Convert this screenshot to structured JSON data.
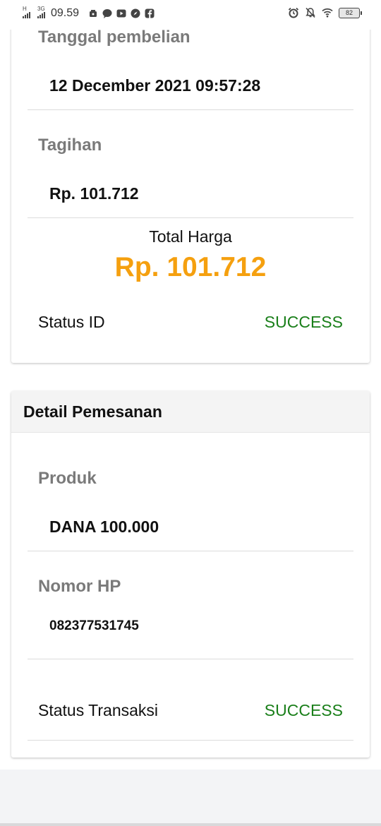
{
  "status_bar": {
    "network_1": "H",
    "network_2": "3G",
    "time": "09.59",
    "battery": "82",
    "icons": [
      "notification-icon",
      "chat-icon",
      "youtube-icon",
      "compass-icon",
      "facebook-icon",
      "alarm-icon",
      "mute-icon",
      "wifi-icon"
    ]
  },
  "payment_card": {
    "purchase_date_label": "Tanggal pembelian",
    "purchase_date_value": "12 December 2021 09:57:28",
    "bill_label": "Tagihan",
    "bill_value": "Rp. 101.712",
    "total_label": "Total Harga",
    "total_value": "Rp. 101.712",
    "status_label": "Status ID",
    "status_value": "SUCCESS"
  },
  "order_card": {
    "title": "Detail Pemesanan",
    "product_label": "Produk",
    "product_value": "DANA 100.000",
    "phone_label": "Nomor HP",
    "phone_value": "082377531745",
    "status_label": "Status Transaksi",
    "status_value": "SUCCESS"
  },
  "colors": {
    "accent": "#f5a00f",
    "success": "#1a7f1a",
    "label_gray": "#7a7a7a"
  }
}
